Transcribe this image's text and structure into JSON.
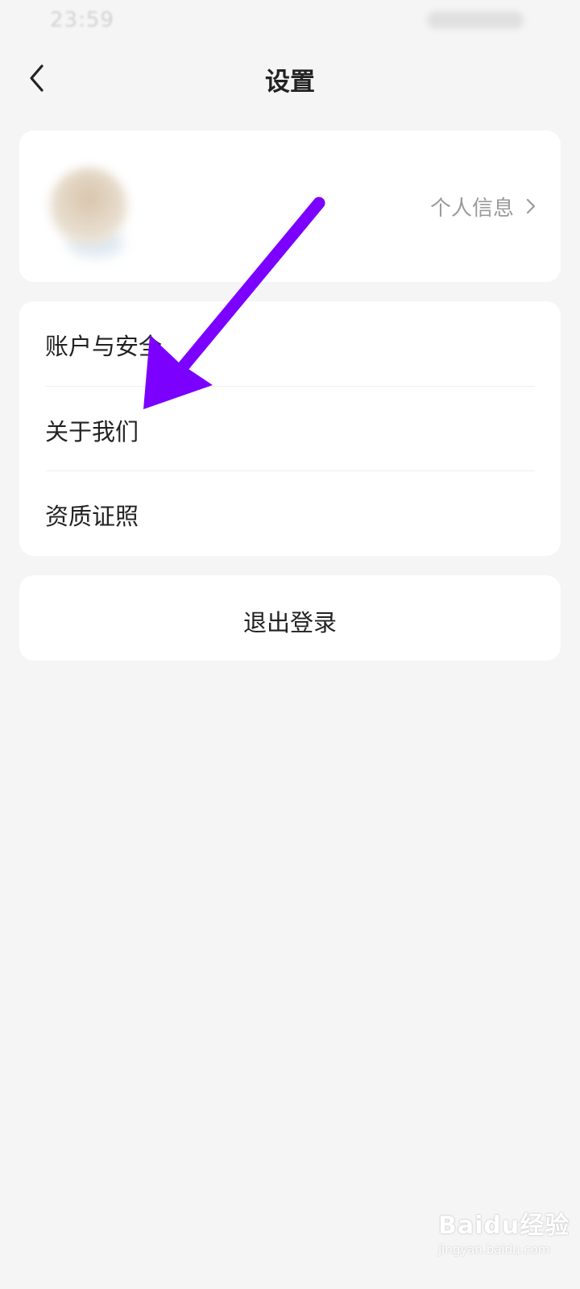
{
  "status_bar": {
    "time": "23:59"
  },
  "header": {
    "title": "设置",
    "back_icon": "chevron-left-icon"
  },
  "profile": {
    "personal_info_label": "个人信息",
    "chevron_icon": "chevron-right-icon"
  },
  "menu": {
    "items": [
      {
        "label": "账户与安全"
      },
      {
        "label": "关于我们"
      },
      {
        "label": "资质证照"
      }
    ]
  },
  "logout": {
    "label": "退出登录"
  },
  "annotation": {
    "arrow_color": "#7b00ff",
    "arrow_icon": "annotation-arrow"
  },
  "watermark": {
    "text": "Baidu经验",
    "url_text": "jingyan.baidu.com"
  },
  "colors": {
    "background": "#f5f5f5",
    "card": "#ffffff",
    "primary_text": "#222222",
    "secondary_text": "#9a9a9a"
  }
}
